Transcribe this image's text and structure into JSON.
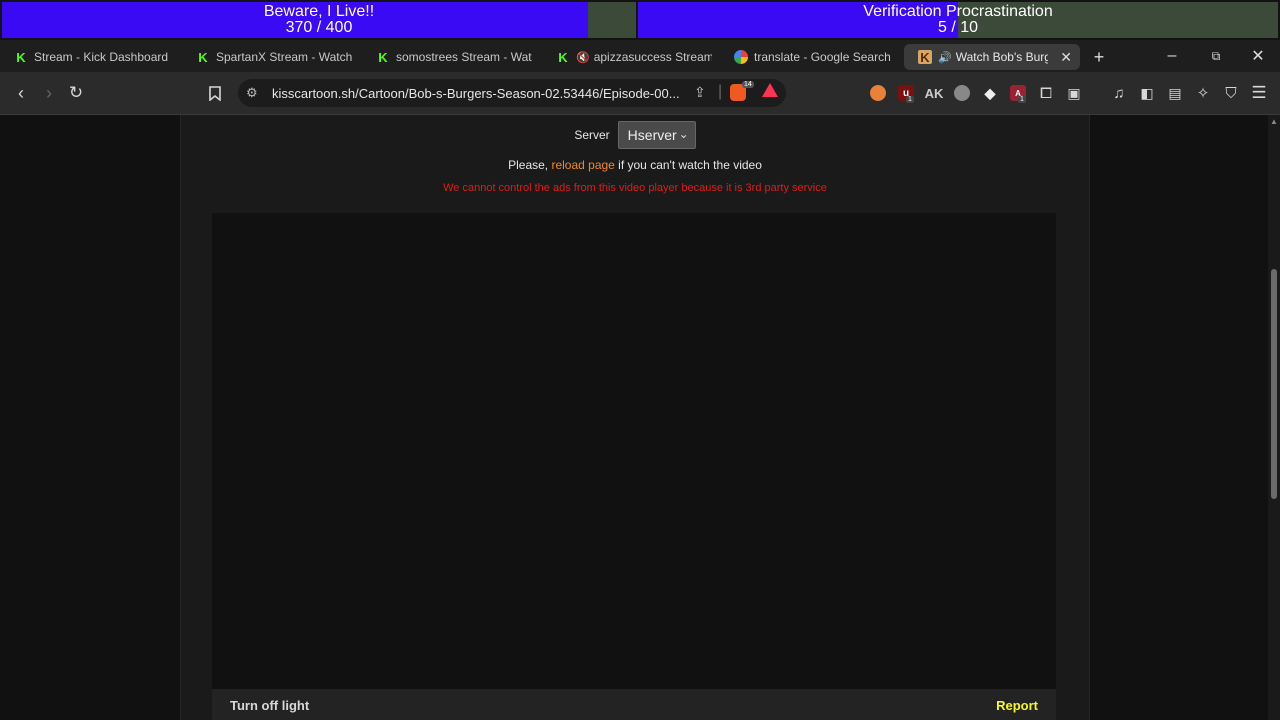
{
  "goals": [
    {
      "title": "Beware, I Live!!",
      "current": "370",
      "target": "400",
      "progress_text": "370 / 400",
      "progress": 0.925
    },
    {
      "title": "Verification Procrastination",
      "current": "5",
      "target": "10",
      "progress_text": "5 / 10",
      "progress": 0.5
    }
  ],
  "tabs": [
    {
      "label": "Stream - Kick Dashboard",
      "favicon": "kick-logo-icon",
      "muted": false,
      "active": false
    },
    {
      "label": "SpartanX Stream - Watch Live",
      "favicon": "kick-logo-icon",
      "muted": false,
      "active": false
    },
    {
      "label": "somostrees Stream - Watch",
      "favicon": "kick-logo-icon",
      "muted": false,
      "active": false
    },
    {
      "label": "apizzasuccess Stream - ",
      "favicon": "kick-logo-icon",
      "muted": true,
      "active": false
    },
    {
      "label": "translate - Google Search",
      "favicon": "google-icon",
      "muted": false,
      "active": false
    },
    {
      "label": "Watch Bob's Burgers",
      "favicon": "kisscartoon-icon",
      "muted": false,
      "audio": true,
      "active": true
    }
  ],
  "browser": {
    "url": "kisscartoon.sh/Cartoon/Bob-s-Burgers-Season-02.53446/Episode-00...",
    "brave_badge": "14",
    "ublock_badge": "1",
    "ext_badge": "1"
  },
  "page": {
    "server_label": "Server",
    "server_selected": "Hserver",
    "note_prefix": "Please, ",
    "note_link": "reload page",
    "note_suffix": " if you can't watch the video",
    "warning": "We cannot control the ads from this video player because it is 3rd party service",
    "turn_off_light": "Turn off light",
    "report": "Report"
  },
  "colors": {
    "goal_fill": "#3a0af5",
    "kick_green": "#53fc18",
    "link_orange": "#f0882a",
    "warning_red": "#e01b1b",
    "report_yellow": "#f7f722"
  }
}
